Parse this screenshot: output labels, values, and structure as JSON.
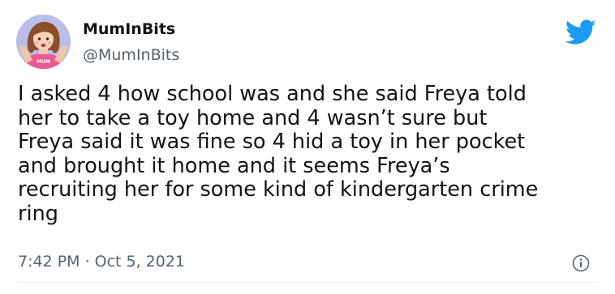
{
  "author": {
    "display_name": "MumInBits",
    "handle": "@MumInBits",
    "avatar_icon": "cartoon-woman-avatar",
    "avatar_shirt_text": "MUM"
  },
  "brand": {
    "icon": "twitter-bird-icon",
    "color": "#1d9bf0"
  },
  "tweet": {
    "text": "I asked 4 how school was and she said Freya told\nher to take a toy home and 4 wasn’t sure but\nFreya said it was fine so 4 hid a toy in her pocket\nand brought it home and it seems Freya’s\nrecruiting her for some kind of kindergarten crime\nring",
    "time": "7:42 PM",
    "separator": "·",
    "date": "Oct 5, 2021"
  },
  "info_icon": "info-circle-icon",
  "colors": {
    "text_primary": "#0f1419",
    "text_secondary": "#536471",
    "divider": "#e6ecf0"
  }
}
